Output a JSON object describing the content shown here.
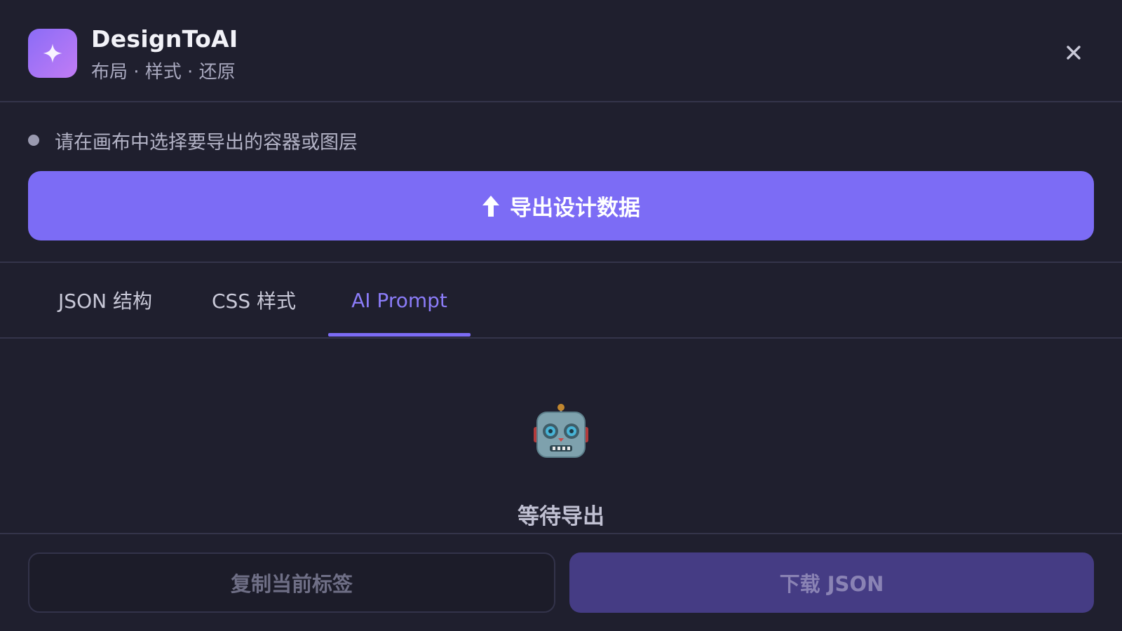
{
  "header": {
    "title": "DesignToAI",
    "subtitle": "布局 · 样式 · 还原",
    "logo_icon": "sparkle-icon",
    "close_icon": "close-icon"
  },
  "status": {
    "text": "请在画布中选择要导出的容器或图层"
  },
  "export_button": {
    "label": "导出设计数据",
    "icon": "arrow-up-icon"
  },
  "tabs": [
    {
      "label": "JSON 结构",
      "active": false
    },
    {
      "label": "CSS 样式",
      "active": false
    },
    {
      "label": "AI Prompt",
      "active": true
    }
  ],
  "empty_state": {
    "icon": "robot-icon",
    "text": "等待导出"
  },
  "footer": {
    "copy_label": "复制当前标签",
    "download_label": "下载 JSON"
  },
  "colors": {
    "background": "#1f1f2e",
    "accent": "#7c6cf5",
    "accent_text": "#8b7cf8",
    "divider": "#34344a",
    "download_bg": "#453c84"
  }
}
